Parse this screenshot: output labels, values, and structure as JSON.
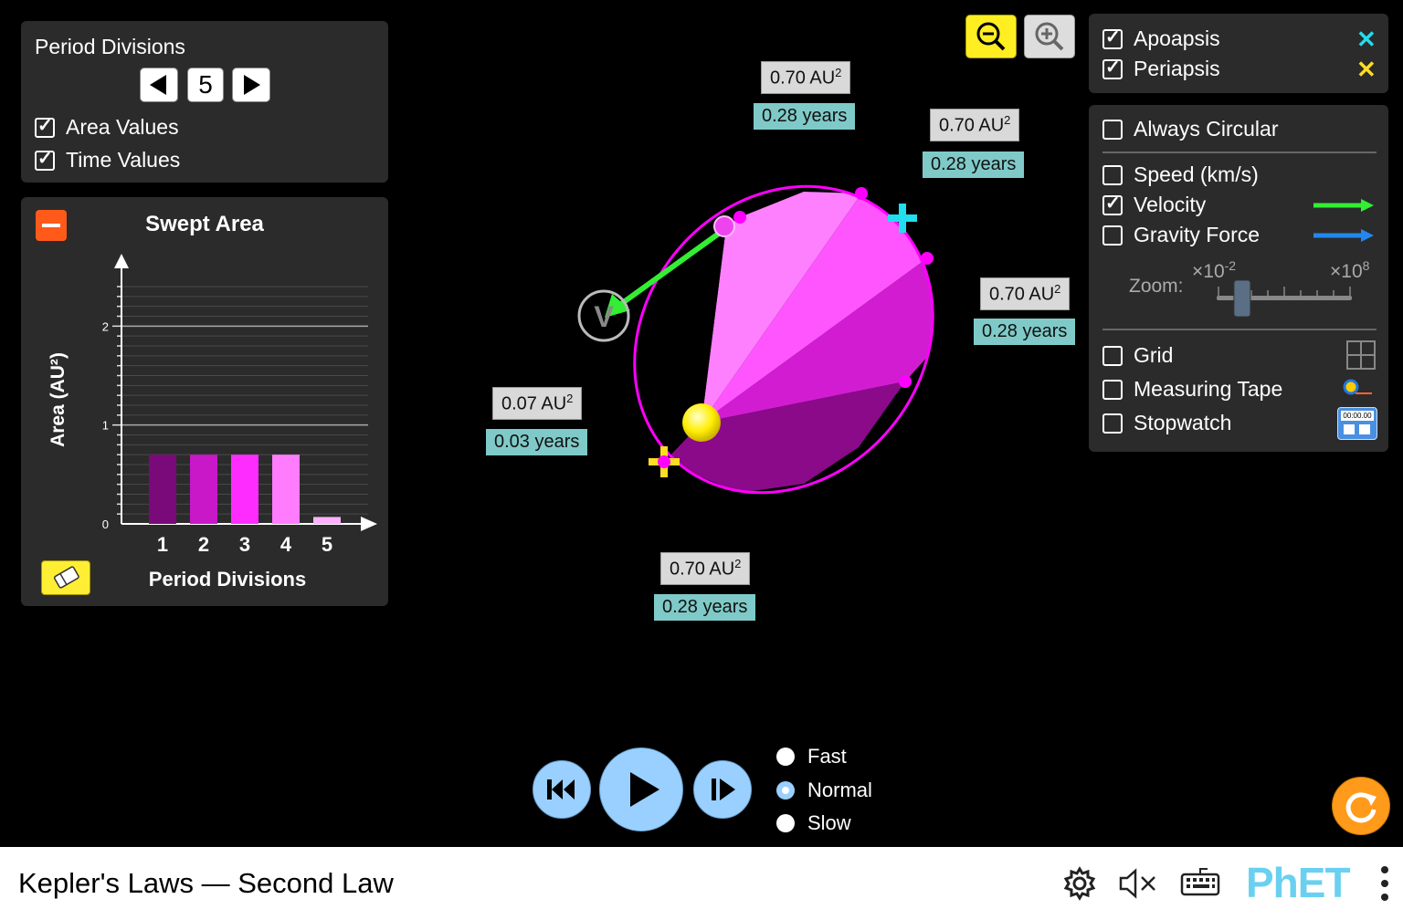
{
  "app": {
    "title": "Kepler's Laws — Second Law"
  },
  "period_panel": {
    "title": "Period Divisions",
    "divisions_value": "5",
    "area_values_label": "Area Values",
    "time_values_label": "Time Values",
    "area_values_checked": true,
    "time_values_checked": true
  },
  "swept_area_panel": {
    "title": "Swept Area",
    "ylabel": "Area (AU²)",
    "xlabel": "Period Divisions"
  },
  "chart_data": {
    "type": "bar",
    "title": "Swept Area",
    "xlabel": "Period Divisions",
    "ylabel": "Area (AU²)",
    "categories": [
      "1",
      "2",
      "3",
      "4",
      "5"
    ],
    "values": [
      0.7,
      0.7,
      0.7,
      0.7,
      0.07
    ],
    "colors": [
      "#7a0a7a",
      "#c818c8",
      "#ff2cff",
      "#ff7cff",
      "#ffb0ff"
    ],
    "ylim": [
      0,
      2.4
    ],
    "yticks": [
      "0",
      "1",
      "2"
    ],
    "grid": true
  },
  "orbit_labels": [
    {
      "area": "0.70 AU",
      "time": "0.28 years"
    },
    {
      "area": "0.70 AU",
      "time": "0.28 years"
    },
    {
      "area": "0.70 AU",
      "time": "0.28 years"
    },
    {
      "area": "0.07 AU",
      "time": "0.03 years"
    },
    {
      "area": "0.70 AU",
      "time": "0.28 years"
    }
  ],
  "area_unit_exponent": "2",
  "velocity_label": "V",
  "right_top_panel": {
    "apoapsis_label": "Apoapsis",
    "periapsis_label": "Periapsis",
    "apoapsis_checked": true,
    "periapsis_checked": true
  },
  "right_panel": {
    "always_circular": "Always Circular",
    "speed": "Speed (km/s)",
    "velocity": "Velocity",
    "gravity": "Gravity Force",
    "zoom_label": "Zoom:",
    "zoom_min": "×10",
    "zoom_min_exp": "-2",
    "zoom_max": "×10",
    "zoom_max_exp": "8",
    "zoom_level_fraction": 0.18,
    "grid": "Grid",
    "measuring_tape": "Measuring Tape",
    "stopwatch": "Stopwatch",
    "stopwatch_time": "00:00.00",
    "velocity_checked": true
  },
  "speed_options": {
    "fast": "Fast",
    "normal": "Normal",
    "slow": "Slow",
    "selected": "Normal"
  },
  "colors": {
    "panel": "#2b2b2b",
    "orbit": "#ff00ff",
    "velocity": "#33ee33",
    "gravity": "#2288ee",
    "sun": "#ffee00",
    "area_label_bg": "#d9d9d9",
    "time_label_bg": "#7fcac8",
    "play_button": "#9ad0ff",
    "reset_button": "#ff9a1a"
  }
}
